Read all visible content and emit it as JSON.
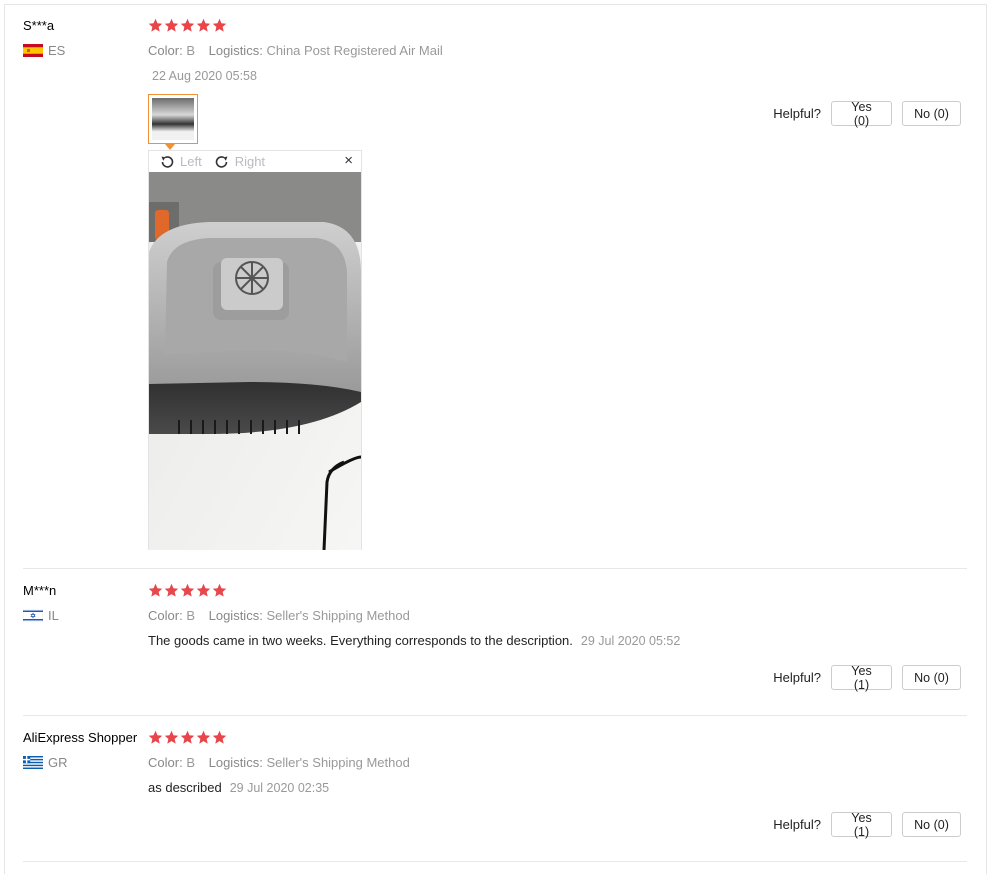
{
  "colors": {
    "star": "#e8464b",
    "accent": "#f39036",
    "divider": "#e8e8e8"
  },
  "helpful_label": "Helpful?",
  "reviews": [
    {
      "user": "S***a",
      "country": "ES",
      "flag": "spain-flag",
      "rating": 5,
      "color_label": "Color:",
      "color_value": "B",
      "logistics_label": "Logistics:",
      "logistics_value": "China Post Registered Air Mail",
      "feedback": "",
      "date": "22 Aug 2020 05:58",
      "yes": "Yes (0)",
      "no": "No (0)"
    },
    {
      "user": "M***n",
      "country": "IL",
      "flag": "israel-flag",
      "rating": 5,
      "color_label": "Color:",
      "color_value": "B",
      "logistics_label": "Logistics:",
      "logistics_value": "Seller's Shipping Method",
      "feedback": "The goods came in two weeks. Everything corresponds to the description.",
      "date": "29 Jul 2020 05:52",
      "yes": "Yes (1)",
      "no": "No (0)"
    },
    {
      "user": "AliExpress Shopper",
      "country": "GR",
      "flag": "greece-flag",
      "rating": 5,
      "color_label": "Color:",
      "color_value": "B",
      "logistics_label": "Logistics:",
      "logistics_value": "Seller's Shipping Method",
      "feedback": "as described",
      "date": "29 Jul 2020 02:35",
      "yes": "Yes (1)",
      "no": "No (0)"
    }
  ],
  "viewer": {
    "rotate_left": "Left",
    "rotate_right": "Right",
    "close": "×"
  }
}
